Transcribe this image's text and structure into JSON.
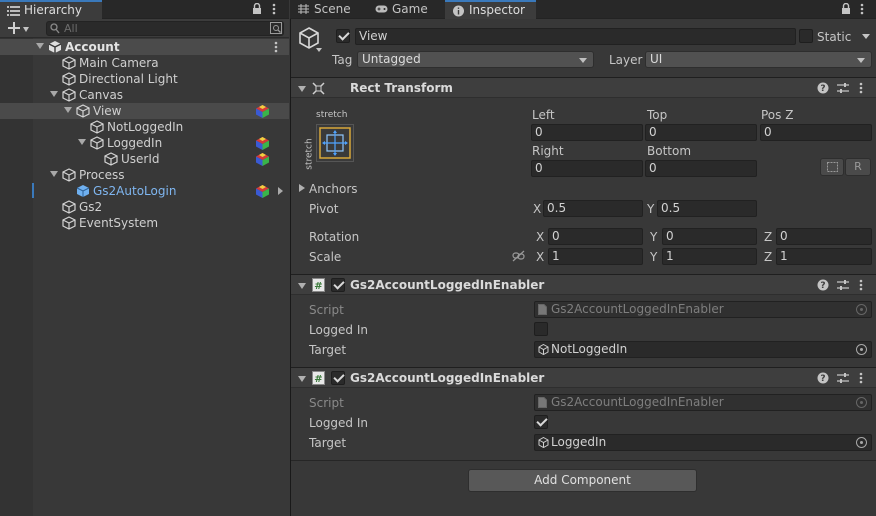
{
  "hierarchy": {
    "tab_label": "Hierarchy",
    "search_placeholder": "All",
    "rows": [
      {
        "label": "Account",
        "depth": 0,
        "kind": "scene",
        "expanded": true
      },
      {
        "label": "Main Camera",
        "depth": 1,
        "kind": "object"
      },
      {
        "label": "Directional Light",
        "depth": 1,
        "kind": "object"
      },
      {
        "label": "Canvas",
        "depth": 1,
        "kind": "object",
        "expanded": true
      },
      {
        "label": "View",
        "depth": 2,
        "kind": "object",
        "expanded": true,
        "selected": true,
        "badge": true
      },
      {
        "label": "NotLoggedIn",
        "depth": 3,
        "kind": "object"
      },
      {
        "label": "LoggedIn",
        "depth": 3,
        "kind": "object",
        "expanded": true,
        "badge": true
      },
      {
        "label": "UserId",
        "depth": 4,
        "kind": "object",
        "badge": true
      },
      {
        "label": "Process",
        "depth": 1,
        "kind": "object",
        "expanded": true
      },
      {
        "label": "Gs2AutoLogin",
        "depth": 2,
        "kind": "prefab",
        "badge": true,
        "chevron": true
      },
      {
        "label": "Gs2",
        "depth": 1,
        "kind": "object"
      },
      {
        "label": "EventSystem",
        "depth": 1,
        "kind": "object"
      }
    ]
  },
  "tabs": {
    "scene": "Scene",
    "game": "Game",
    "inspector": "Inspector"
  },
  "object": {
    "name": "View",
    "static_label": "Static",
    "tag_label": "Tag",
    "tag_value": "Untagged",
    "layer_label": "Layer",
    "layer_value": "UI"
  },
  "rect_transform": {
    "title": "Rect Transform",
    "anchor_preset_top": "stretch",
    "anchor_preset_side": "stretch",
    "left_label": "Left",
    "left_value": "0",
    "top_label": "Top",
    "top_value": "0",
    "posz_label": "Pos Z",
    "posz_value": "0",
    "right_label": "Right",
    "right_value": "0",
    "bottom_label": "Bottom",
    "bottom_value": "0",
    "r_button": "R",
    "anchors_label": "Anchors",
    "pivot_label": "Pivot",
    "pivot_x": "0.5",
    "pivot_y": "0.5",
    "rotation_label": "Rotation",
    "rot_x": "0",
    "rot_y": "0",
    "rot_z": "0",
    "scale_label": "Scale",
    "scale_x": "1",
    "scale_y": "1",
    "scale_z": "1",
    "axis_x": "X",
    "axis_y": "Y",
    "axis_z": "Z"
  },
  "components": [
    {
      "title": "Gs2AccountLoggedInEnabler",
      "script_label": "Script",
      "script_value": "Gs2AccountLoggedInEnabler",
      "logged_in_label": "Logged In",
      "logged_in": false,
      "target_label": "Target",
      "target_value": "NotLoggedIn"
    },
    {
      "title": "Gs2AccountLoggedInEnabler",
      "script_label": "Script",
      "script_value": "Gs2AccountLoggedInEnabler",
      "logged_in_label": "Logged In",
      "logged_in": true,
      "target_label": "Target",
      "target_value": "LoggedIn"
    }
  ],
  "add_component_label": "Add Component",
  "colors": {
    "accent": "#3a79bb",
    "prefab_text": "#7fb6f0",
    "panel_bg": "#383838",
    "header_bg": "#3e3e3e"
  }
}
